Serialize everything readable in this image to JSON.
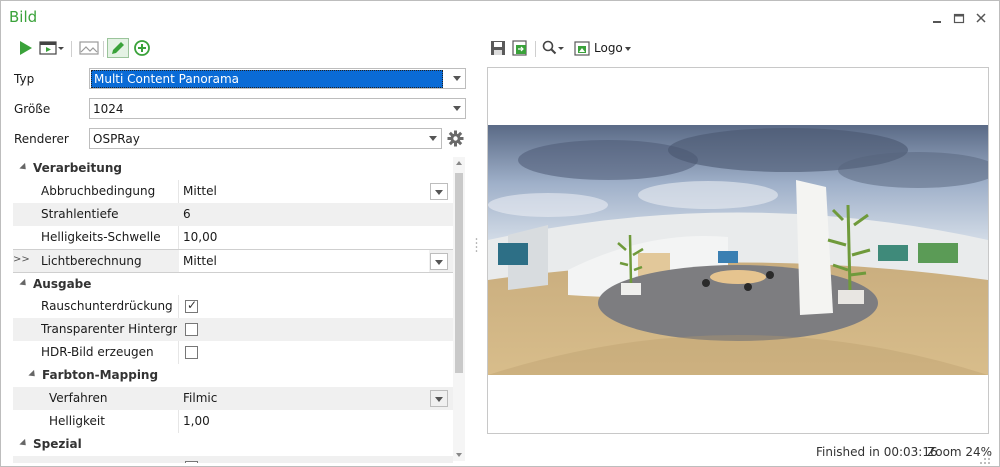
{
  "window": {
    "title": "Bild"
  },
  "form": {
    "typ": {
      "label": "Typ",
      "value": "Multi Content Panorama"
    },
    "groesse": {
      "label": "Größe",
      "value": "1024"
    },
    "renderer": {
      "label": "Renderer",
      "value": "OSPRay"
    }
  },
  "grid": {
    "verarbeitung": "Verarbeitung",
    "abbruch": {
      "label": "Abbruchbedingung",
      "value": "Mittel"
    },
    "strahlen": {
      "label": "Strahlentiefe",
      "value": "6"
    },
    "helligkeitsschwelle": {
      "label": "Helligkeits-Schwelle",
      "value": "10,00"
    },
    "licht": {
      "label": "Lichtberechnung",
      "value": "Mittel"
    },
    "ausgabe": "Ausgabe",
    "rausch": {
      "label": "Rauschunterdrückung",
      "checked": true
    },
    "transparent": {
      "label": "Transparenter Hintergru...",
      "checked": false
    },
    "hdr": {
      "label": "HDR-Bild erzeugen",
      "checked": false
    },
    "farbton": "Farbton-Mapping",
    "verfahren": {
      "label": "Verfahren",
      "value": "Filmic"
    },
    "helligkeit": {
      "label": "Helligkeit",
      "value": "1,00"
    },
    "spezial": "Spezial",
    "row_marker": ">>"
  },
  "right_toolbar": {
    "logo_label": "Logo"
  },
  "status": {
    "finished": "Finished in 00:03:16",
    "zoom": "Zoom 24%"
  },
  "colors": {
    "accent": "#3aa23a",
    "selection": "#0a6bd6"
  },
  "icons": [
    "play-icon",
    "render-settings-icon",
    "image-compare-icon",
    "edit-pencil-icon",
    "add-circle-icon",
    "save-icon",
    "export-icon",
    "zoom-icon",
    "logo-icon",
    "gear-icon"
  ]
}
